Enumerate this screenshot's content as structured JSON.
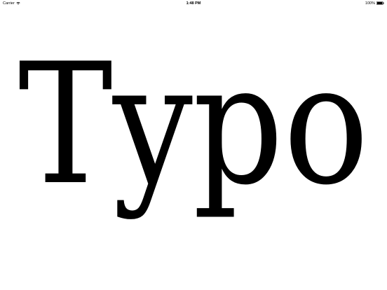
{
  "status_bar": {
    "carrier": "Carrier",
    "wifi_icon": "wifi-icon",
    "time": "1:48 PM",
    "battery_percent": "100%",
    "battery_icon": "battery-icon",
    "battery_level": 1.0
  },
  "main": {
    "hero_text": "Typo",
    "text_color": "#000000",
    "background_color": "#ffffff"
  }
}
